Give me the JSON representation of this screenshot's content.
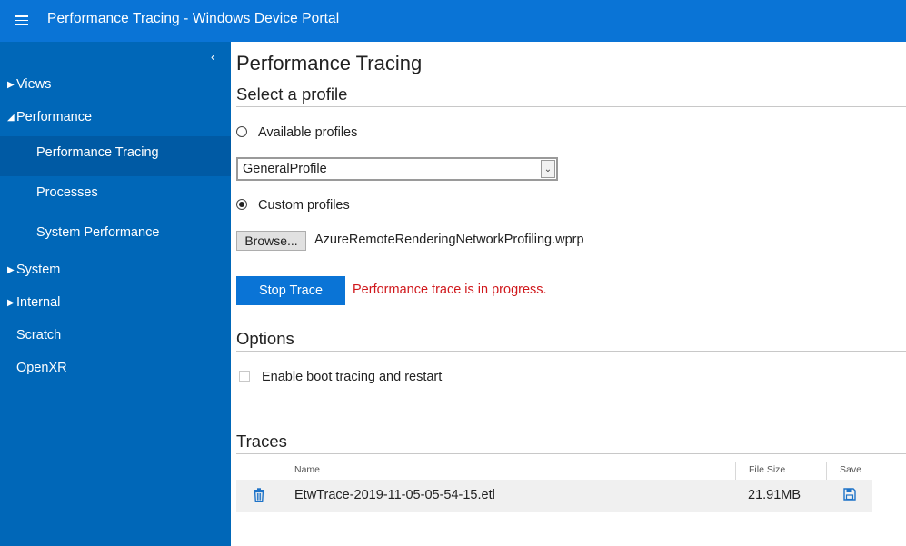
{
  "header": {
    "title": "Performance Tracing - Windows Device Portal"
  },
  "sidebar": {
    "collapse_glyph": "‹",
    "items": [
      {
        "label": "Views",
        "arrow": "▶"
      },
      {
        "label": "Performance",
        "arrow": "◢"
      },
      {
        "label": "Performance Tracing"
      },
      {
        "label": "Processes"
      },
      {
        "label": "System Performance"
      },
      {
        "label": "System",
        "arrow": "▶"
      },
      {
        "label": "Internal",
        "arrow": "▶"
      },
      {
        "label": "Scratch"
      },
      {
        "label": "OpenXR"
      }
    ]
  },
  "main": {
    "page_title": "Performance Tracing",
    "profile_section": "Select a profile",
    "available_profiles_label": "Available profiles",
    "selected_profile": "GeneralProfile",
    "custom_profiles_label": "Custom profiles",
    "browse_label": "Browse...",
    "browse_file": "AzureRemoteRenderingNetworkProfiling.wprp",
    "stop_trace_label": "Stop Trace",
    "status_message": "Performance trace is in progress.",
    "options_section": "Options",
    "boot_tracing_label": "Enable boot tracing and restart",
    "traces_section": "Traces",
    "table": {
      "headers": {
        "name": "Name",
        "size": "File Size",
        "save": "Save"
      },
      "rows": [
        {
          "name": "EtwTrace-2019-11-05-05-54-15.etl",
          "size": "21.91MB"
        }
      ]
    }
  },
  "colors": {
    "header_bg": "#0a74d6",
    "sidebar_bg": "#0067b8",
    "sidebar_active": "#005aa4",
    "status_error": "#d0181c"
  }
}
